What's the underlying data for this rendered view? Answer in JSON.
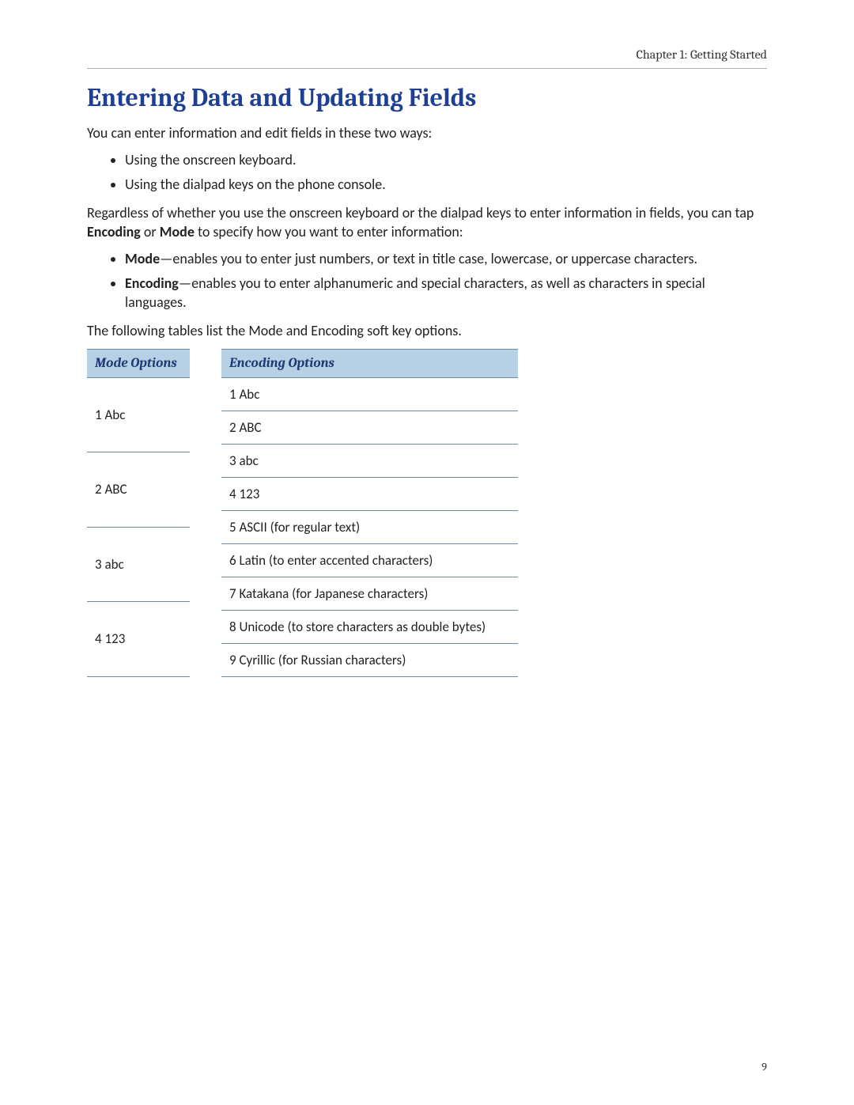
{
  "header": {
    "chapter": "Chapter 1: Getting Started"
  },
  "section": {
    "title": "Entering Data and Updating Fields"
  },
  "intro": "You can enter information and edit fields in these two ways:",
  "ways": {
    "a": "Using the onscreen keyboard.",
    "b": "Using the dialpad keys on the phone console."
  },
  "para2_pre": "Regardless of whether you use the onscreen keyboard or the dialpad keys to enter information in fields, you can tap ",
  "para2_b1": "Encoding",
  "para2_mid": " or ",
  "para2_b2": "Mode",
  "para2_post": " to specify how you want to enter information:",
  "defs": {
    "mode_label": "Mode",
    "mode_text": "—enables you to enter just numbers, or text in title case, lowercase, or uppercase characters.",
    "enc_label": "Encoding",
    "enc_text": "—enables you to enter alphanumeric and special characters, as well as characters in special languages."
  },
  "tables_intro": "The following tables list the Mode and Encoding soft key options.",
  "mode_table": {
    "header": "Mode Options",
    "r1": "1 Abc",
    "r2": "2 ABC",
    "r3": "3 abc",
    "r4": "4 123"
  },
  "enc_table": {
    "header": "Encoding Options",
    "r1": "1 Abc",
    "r2": "2 ABC",
    "r3": "3 abc",
    "r4": "4 123",
    "r5": "5 ASCII (for regular text)",
    "r6": "6 Latin (to enter accented characters)",
    "r7": "7 Katakana (for Japanese characters)",
    "r8": "8 Unicode (to store characters as double bytes)",
    "r9": "9 Cyrillic (for Russian characters)"
  },
  "page_number": "9"
}
